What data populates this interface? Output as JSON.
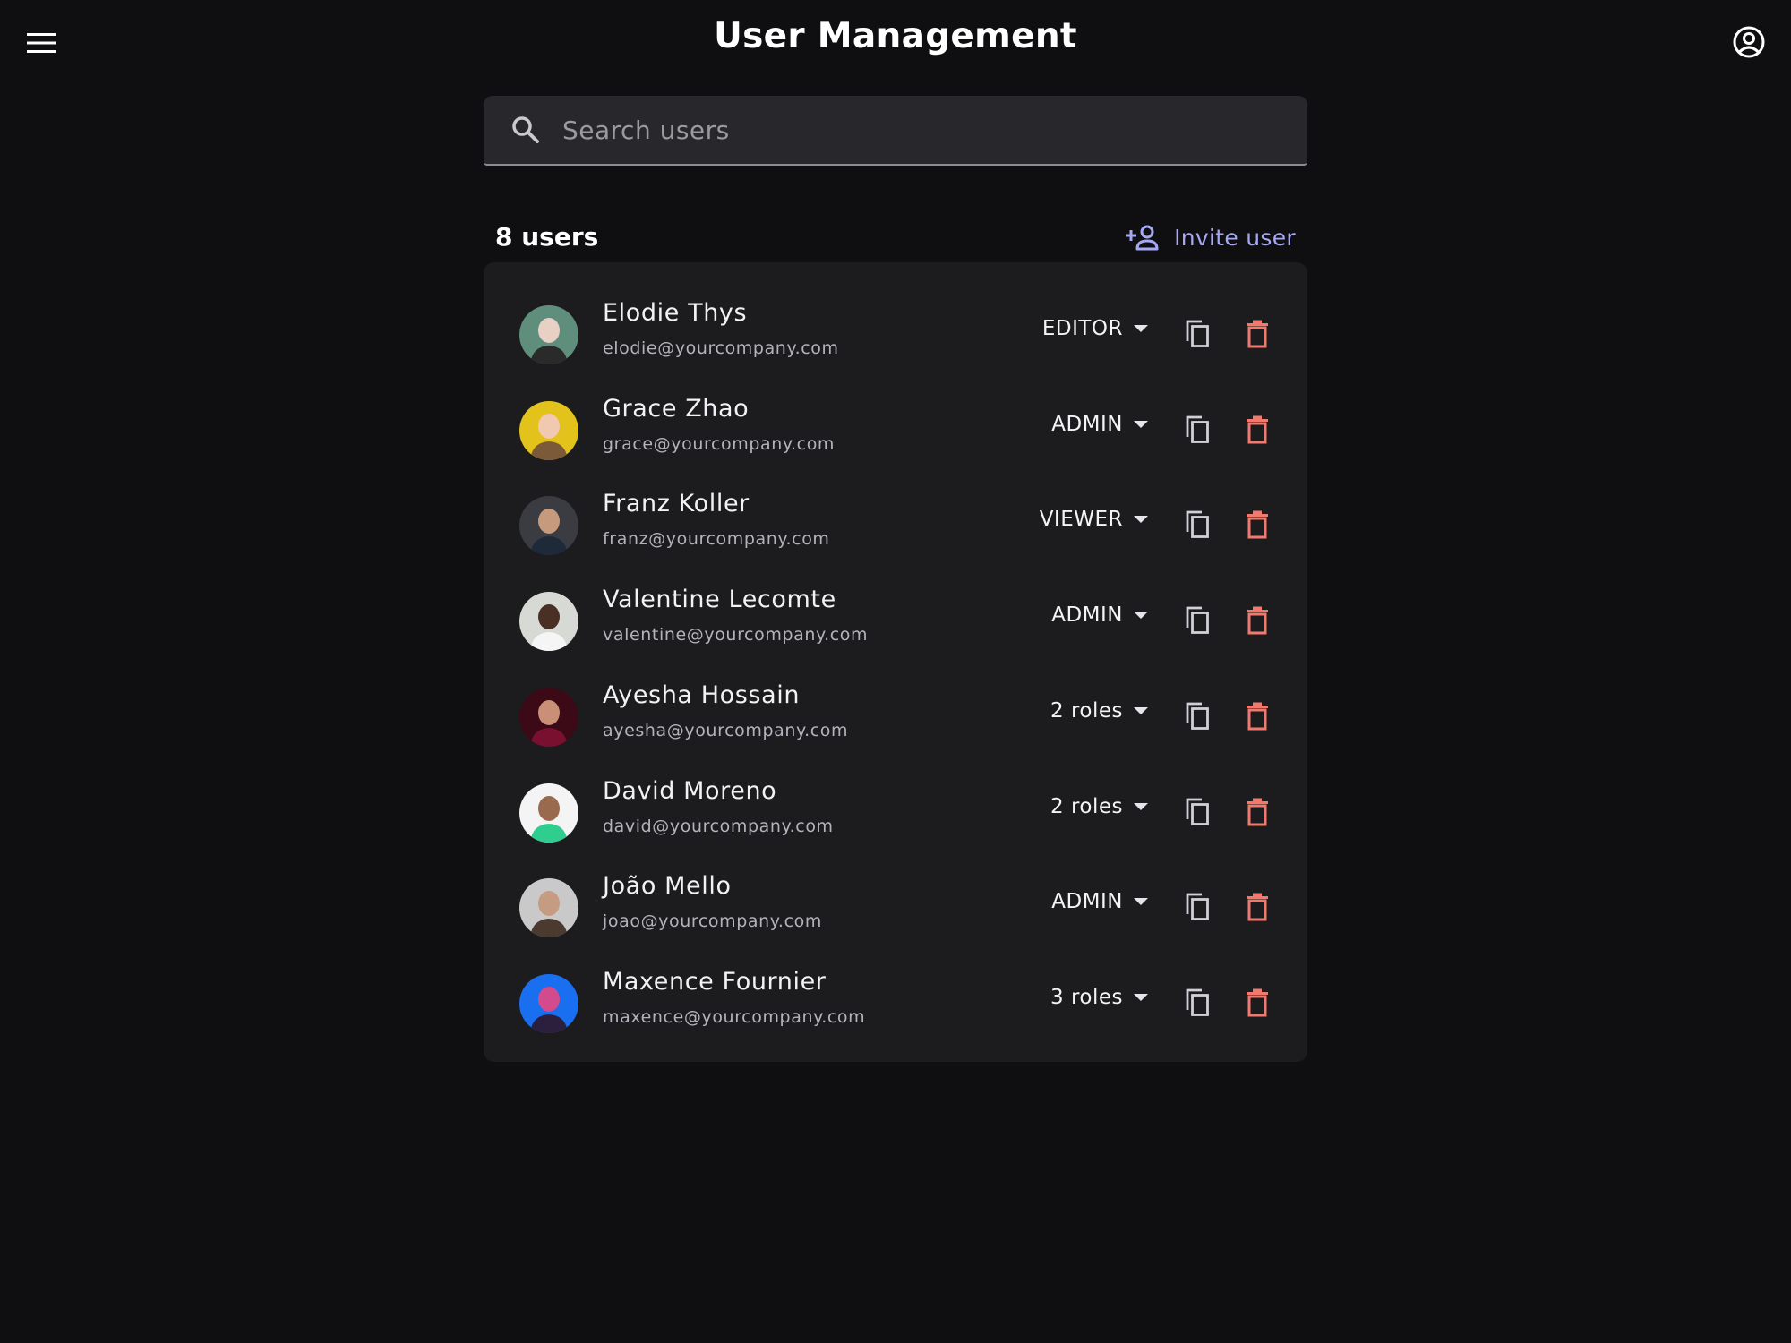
{
  "header": {
    "title": "User Management",
    "menu_icon": "menu-icon",
    "account_icon": "account-circle-icon"
  },
  "search": {
    "placeholder": "Search users",
    "value": "",
    "icon": "search-icon"
  },
  "list": {
    "count_label": "8 users",
    "invite_label": "Invite user",
    "invite_icon": "person-add-icon",
    "users": [
      {
        "name": "Elodie Thys",
        "email": "elodie@yourcompany.com",
        "role": "EDITOR",
        "avatar_colors": [
          "#5f8f7c",
          "#e8d0c4",
          "#2a2a2a"
        ]
      },
      {
        "name": "Grace Zhao",
        "email": "grace@yourcompany.com",
        "role": "ADMIN",
        "avatar_colors": [
          "#e3c21b",
          "#f0c9b0",
          "#7b5a3a"
        ]
      },
      {
        "name": "Franz Koller",
        "email": "franz@yourcompany.com",
        "role": "VIEWER",
        "avatar_colors": [
          "#3b3b42",
          "#c59a7d",
          "#1e2a3a"
        ]
      },
      {
        "name": "Valentine Lecomte",
        "email": "valentine@yourcompany.com",
        "role": "ADMIN",
        "avatar_colors": [
          "#d7d9d4",
          "#4a3024",
          "#f5f5f5"
        ]
      },
      {
        "name": "Ayesha Hossain",
        "email": "ayesha@yourcompany.com",
        "role": "2 roles",
        "avatar_colors": [
          "#3b0a16",
          "#c98f77",
          "#7a1030"
        ]
      },
      {
        "name": "David Moreno",
        "email": "david@yourcompany.com",
        "role": "2 roles",
        "avatar_colors": [
          "#f4f4f4",
          "#9a6a4e",
          "#2fce8f"
        ]
      },
      {
        "name": "João Mello",
        "email": "joao@yourcompany.com",
        "role": "ADMIN",
        "avatar_colors": [
          "#c9c9c9",
          "#c59c82",
          "#4a3a30"
        ]
      },
      {
        "name": "Maxence Fournier",
        "email": "maxence@yourcompany.com",
        "role": "3 roles",
        "avatar_colors": [
          "#1a6ef0",
          "#d24b8c",
          "#2b1f3d"
        ]
      }
    ],
    "copy_icon": "copy-icon",
    "delete_icon": "trash-icon"
  },
  "colors": {
    "background": "#0f0f11",
    "card": "#1c1c1f",
    "accent": "#a7a8f2",
    "danger": "#f07a6e"
  }
}
